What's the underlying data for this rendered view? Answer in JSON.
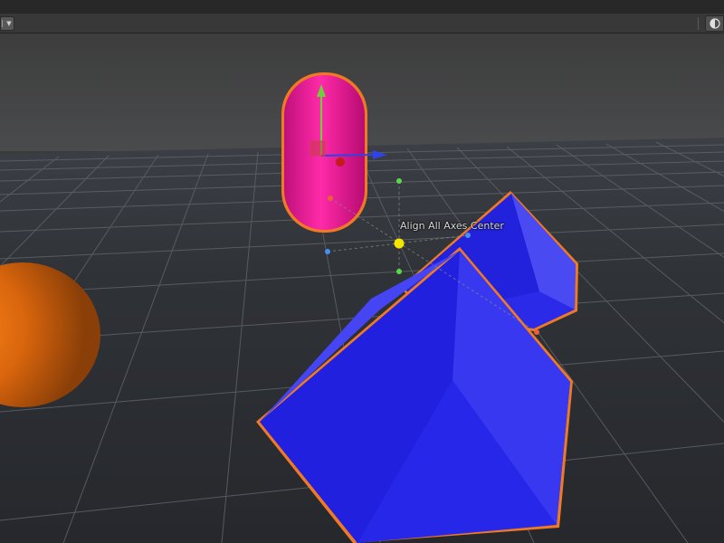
{
  "toolbar": {
    "left_tool": {
      "icon": "hand-tool-icon",
      "dropdown_icon": "chevron-down-icon"
    },
    "right_tool": {
      "icon": "shading-mode-icon"
    }
  },
  "viewport": {
    "handle_label": "Align All Axes Center",
    "background": "#3a3a3a",
    "ground_color": "#2b2d31",
    "grid_color": "#5f6268",
    "objects": [
      {
        "name": "capsule",
        "color": "#e8168f",
        "selected": true
      },
      {
        "name": "sphere",
        "color": "#e26a0c",
        "selected": false
      },
      {
        "name": "cube-1",
        "color": "#2121e6",
        "selected": true
      },
      {
        "name": "cube-2",
        "color": "#2121e6",
        "selected": true
      }
    ],
    "selection_outline_color": "#f07a24",
    "gizmo": {
      "x_axis_color": "#2e44e8",
      "y_axis_color": "#6ed03a",
      "z_axis_color": "#c41a1a",
      "center_handle_color": "#f5e600"
    }
  }
}
